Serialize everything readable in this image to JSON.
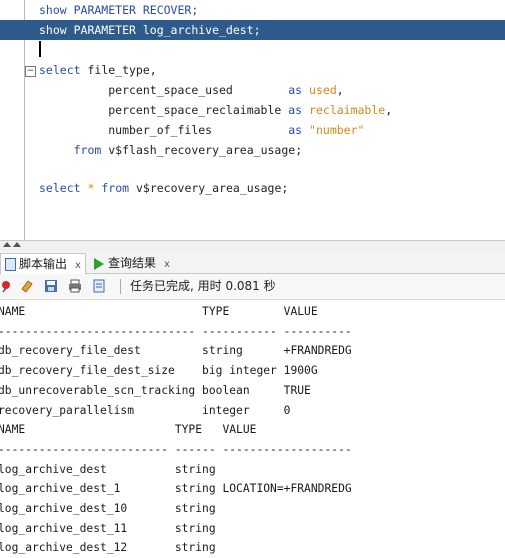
{
  "editor": {
    "lines": [
      [
        {
          "t": "show PARAMETER RECOVER;",
          "c": "kw"
        }
      ],
      [
        {
          "t": "show PARAMETER log_archive_dest;",
          "c": ""
        }
      ],
      [],
      [
        {
          "t": "select",
          "c": "kw"
        },
        {
          "t": " file_type,",
          "c": "plain"
        }
      ],
      [
        {
          "t": "          percent_space_used        ",
          "c": "plain"
        },
        {
          "t": "as",
          "c": "kw"
        },
        {
          "t": " ",
          "c": "plain"
        },
        {
          "t": "used",
          "c": "str"
        },
        {
          "t": ",",
          "c": "plain"
        }
      ],
      [
        {
          "t": "          percent_space_reclaimable ",
          "c": "plain"
        },
        {
          "t": "as",
          "c": "kw"
        },
        {
          "t": " ",
          "c": "plain"
        },
        {
          "t": "reclaimable",
          "c": "str"
        },
        {
          "t": ",",
          "c": "plain"
        }
      ],
      [
        {
          "t": "          number_of_files           ",
          "c": "plain"
        },
        {
          "t": "as",
          "c": "kw"
        },
        {
          "t": " ",
          "c": "plain"
        },
        {
          "t": "\"number\"",
          "c": "str"
        }
      ],
      [
        {
          "t": "     ",
          "c": "plain"
        },
        {
          "t": "from",
          "c": "kw"
        },
        {
          "t": " v$flash_recovery_area_usage;",
          "c": "plain"
        }
      ],
      [],
      [
        {
          "t": "select",
          "c": "kw"
        },
        {
          "t": " ",
          "c": "plain"
        },
        {
          "t": "*",
          "c": "star"
        },
        {
          "t": " ",
          "c": "plain"
        },
        {
          "t": "from",
          "c": "kw"
        },
        {
          "t": " v$recovery_area_usage;",
          "c": "plain"
        }
      ]
    ],
    "fold_symbol": "−"
  },
  "tabs": {
    "script_output": "脚本输出",
    "query_result": "查询结果",
    "close": "x"
  },
  "toolbar": {
    "status": "任务已完成, 用时 0.081 秒"
  },
  "output": {
    "lines": [
      "NAME                          TYPE        VALUE",
      "----------------------------- ----------- ----------",
      "db_recovery_file_dest         string      +FRANDREDG",
      "db_recovery_file_dest_size    big integer 1900G",
      "db_unrecoverable_scn_tracking boolean     TRUE",
      "recovery_parallelism          integer     0",
      "NAME                      TYPE   VALUE",
      "------------------------- ------ -------------------",
      "log_archive_dest          string",
      "log_archive_dest_1        string LOCATION=+FRANDREDG",
      "log_archive_dest_10       string",
      "log_archive_dest_11       string",
      "log_archive_dest_12       string"
    ]
  },
  "colors": {
    "keyword": "#2a4ba8",
    "string": "#d2891a",
    "selection": "#2f5b8c"
  }
}
